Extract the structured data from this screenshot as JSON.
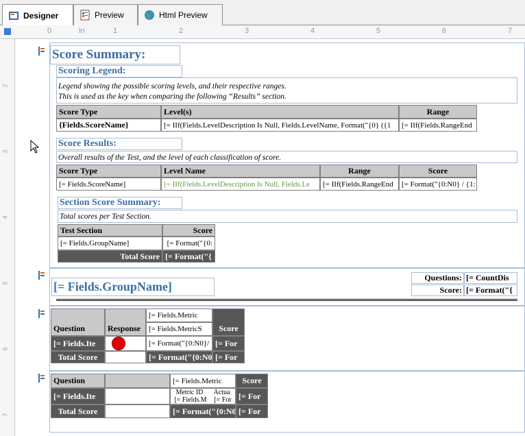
{
  "tabs": [
    {
      "label": "Designer",
      "icon": "designer-icon",
      "active": true
    },
    {
      "label": "Preview",
      "icon": "preview-icon",
      "active": false
    },
    {
      "label": "Html Preview",
      "icon": "globe-icon",
      "active": false
    }
  ],
  "ruler": {
    "unit": "in",
    "marks": [
      "0",
      "1",
      "2",
      "3",
      "4",
      "5",
      "6",
      "7"
    ],
    "vmarks": [
      "2",
      "3",
      "4",
      "5",
      "6",
      "7"
    ]
  },
  "report": {
    "title": "Score Summary:",
    "legend": {
      "heading": "Scoring Legend:",
      "desc1": "Legend showing the possible scoring levels, and their respective ranges.",
      "desc2": "This is used as the key when comparing the following “Results” section.",
      "columns": [
        "Score Type",
        "Level(s)",
        "Range"
      ],
      "row": [
        "{Fields.ScoreName}",
        "[= IIf(Fields.LevelDescription Is Null, Fields.LevelName, Format(\"{0} ({1",
        "[= IIf(Fields.RangeEnd"
      ]
    },
    "results": {
      "heading": "Score Results:",
      "desc": "Overall results of the Test, and the level of each classification of score.",
      "columns": [
        "Score Type",
        "Level Name",
        "Range",
        "Score"
      ],
      "row": [
        "[= Fields.ScoreName]",
        "[= IIf(Fields.LevelDescription Is Null, Fields.Le",
        "[= IIf(Fields.RangeEnd",
        "[= Format(\"{0:N0} / {1:"
      ]
    },
    "sections": {
      "heading": "Section Score Summary:",
      "desc": "Total scores per Test Section.",
      "columns": [
        "Test Section",
        "Score"
      ],
      "row": [
        "[= Fields.GroupName]",
        "[= Format(\"{0:"
      ],
      "total_label": "Total Score",
      "total_value": "[= Format(\"{"
    },
    "group": {
      "title": "[= Fields.GroupName]",
      "questions_label": "Questions:",
      "questions_value": "[= CountDis",
      "score_label": "Score:",
      "score_value": "[= Format(\"{"
    },
    "detail1": {
      "question_hdr": "Question",
      "response_hdr": "Response",
      "metric_hdr": "[= Fields.Metric",
      "metric_sub": "[= Fields.MetricS",
      "score_hdr": "Score",
      "row_question": "[= Fields.Ite",
      "row_metric": "[= Format(\"{0:N0}/",
      "row_score": "[= For",
      "total_label": "Total Score",
      "total_metric": "[= Format(\"{0:N0",
      "total_score": "[= For"
    },
    "detail2": {
      "question_hdr": "Question",
      "metric_hdr": "[= Fields.Metric",
      "score_hdr": "Score",
      "metric_id": "Metric ID",
      "actual": "Actua",
      "row_question": "[= Fields.Ite",
      "row_metric_m": "[= Fields.M",
      "row_metric_f": "[= For",
      "row_score": "[= For",
      "total_label": "Total Score",
      "total_metric": "[= Format(\"{0:N0",
      "total_score": "[= For"
    }
  }
}
